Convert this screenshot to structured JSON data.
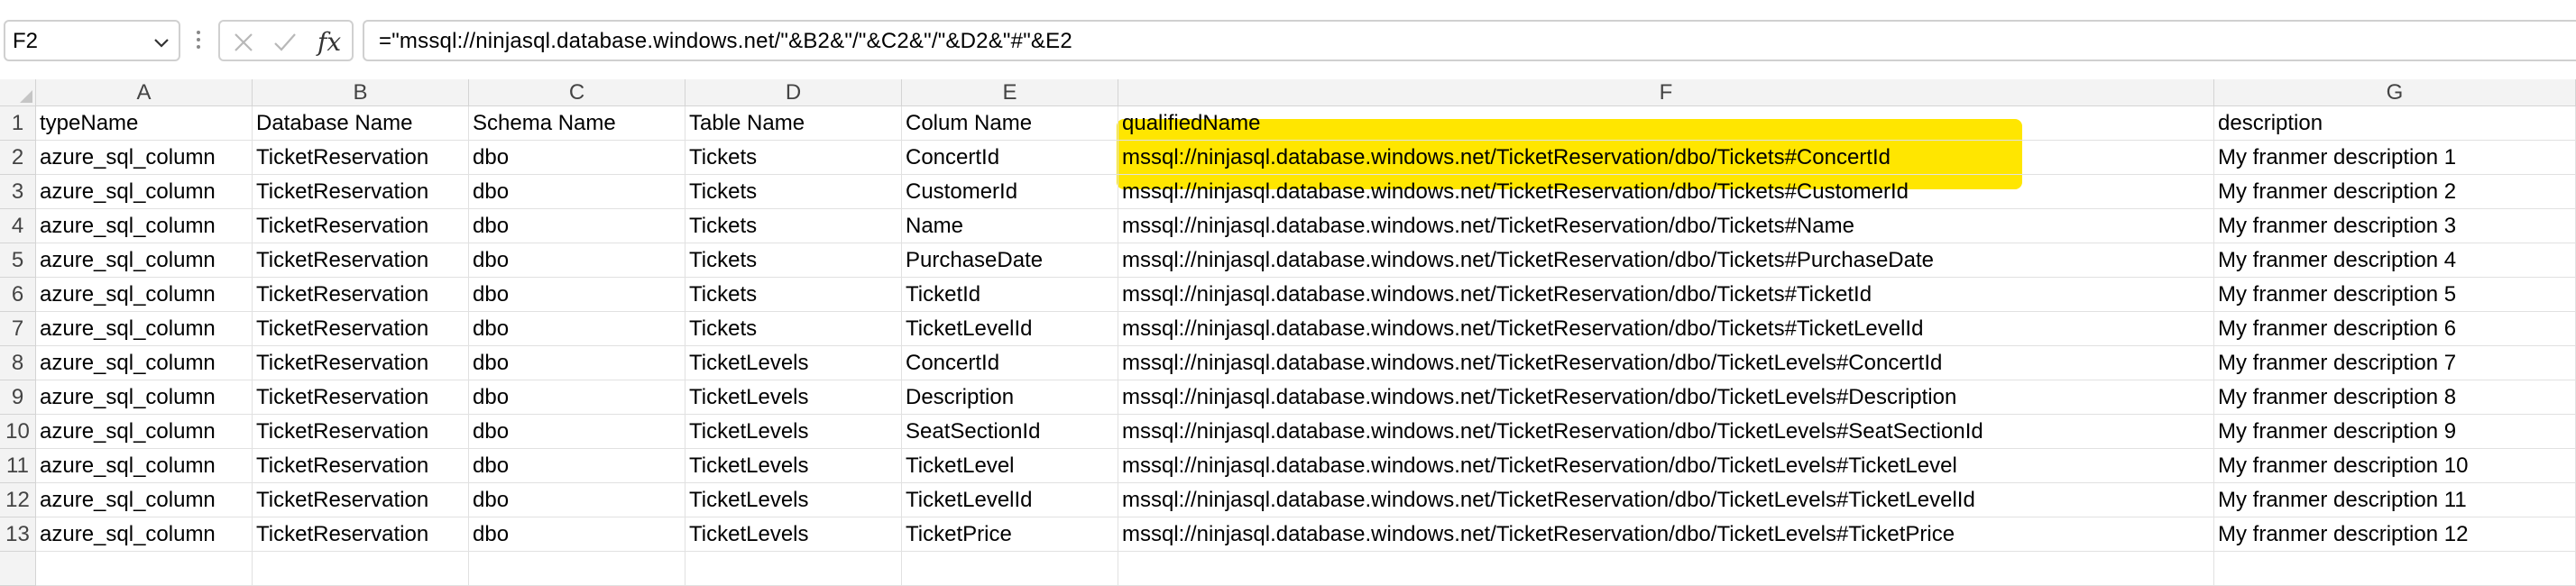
{
  "name_box": {
    "value": "F2",
    "icon": "chevron-down-icon"
  },
  "formula_bar": {
    "cancel_icon": "x-icon",
    "enter_icon": "check-icon",
    "fx_label": "fx",
    "formula": "=\"mssql://ninjasql.database.windows.net/\"&B2&\"/\"&C2&\"/\"&D2&\"#\"&E2"
  },
  "columns": [
    "A",
    "B",
    "C",
    "D",
    "E",
    "F",
    "G"
  ],
  "rows": [
    "1",
    "2",
    "3",
    "4",
    "5",
    "6",
    "7",
    "8",
    "9",
    "10",
    "11",
    "12",
    "13"
  ],
  "header_row": [
    "typeName",
    "Database Name",
    "Schema Name",
    "Table Name",
    "Colum Name",
    "qualifiedName",
    "description"
  ],
  "data_rows": [
    [
      "azure_sql_column",
      "TicketReservation",
      "dbo",
      "Tickets",
      "ConcertId",
      "mssql://ninjasql.database.windows.net/TicketReservation/dbo/Tickets#ConcertId",
      "My franmer description 1"
    ],
    [
      "azure_sql_column",
      "TicketReservation",
      "dbo",
      "Tickets",
      "CustomerId",
      "mssql://ninjasql.database.windows.net/TicketReservation/dbo/Tickets#CustomerId",
      "My franmer description 2"
    ],
    [
      "azure_sql_column",
      "TicketReservation",
      "dbo",
      "Tickets",
      "Name",
      "mssql://ninjasql.database.windows.net/TicketReservation/dbo/Tickets#Name",
      "My franmer description 3"
    ],
    [
      "azure_sql_column",
      "TicketReservation",
      "dbo",
      "Tickets",
      "PurchaseDate",
      "mssql://ninjasql.database.windows.net/TicketReservation/dbo/Tickets#PurchaseDate",
      "My franmer description 4"
    ],
    [
      "azure_sql_column",
      "TicketReservation",
      "dbo",
      "Tickets",
      "TicketId",
      "mssql://ninjasql.database.windows.net/TicketReservation/dbo/Tickets#TicketId",
      "My franmer description 5"
    ],
    [
      "azure_sql_column",
      "TicketReservation",
      "dbo",
      "Tickets",
      "TicketLevelId",
      "mssql://ninjasql.database.windows.net/TicketReservation/dbo/Tickets#TicketLevelId",
      "My franmer description 6"
    ],
    [
      "azure_sql_column",
      "TicketReservation",
      "dbo",
      "TicketLevels",
      "ConcertId",
      "mssql://ninjasql.database.windows.net/TicketReservation/dbo/TicketLevels#ConcertId",
      "My franmer description 7"
    ],
    [
      "azure_sql_column",
      "TicketReservation",
      "dbo",
      "TicketLevels",
      "Description",
      "mssql://ninjasql.database.windows.net/TicketReservation/dbo/TicketLevels#Description",
      "My franmer description 8"
    ],
    [
      "azure_sql_column",
      "TicketReservation",
      "dbo",
      "TicketLevels",
      "SeatSectionId",
      "mssql://ninjasql.database.windows.net/TicketReservation/dbo/TicketLevels#SeatSectionId",
      "My franmer description 9"
    ],
    [
      "azure_sql_column",
      "TicketReservation",
      "dbo",
      "TicketLevels",
      "TicketLevel",
      "mssql://ninjasql.database.windows.net/TicketReservation/dbo/TicketLevels#TicketLevel",
      "My franmer description 10"
    ],
    [
      "azure_sql_column",
      "TicketReservation",
      "dbo",
      "TicketLevels",
      "TicketLevelId",
      "mssql://ninjasql.database.windows.net/TicketReservation/dbo/TicketLevels#TicketLevelId",
      "My franmer description 11"
    ],
    [
      "azure_sql_column",
      "TicketReservation",
      "dbo",
      "TicketLevels",
      "TicketPrice",
      "mssql://ninjasql.database.windows.net/TicketReservation/dbo/TicketLevels#TicketPrice",
      "My franmer description 12"
    ]
  ],
  "highlight_color": "#ffe600"
}
